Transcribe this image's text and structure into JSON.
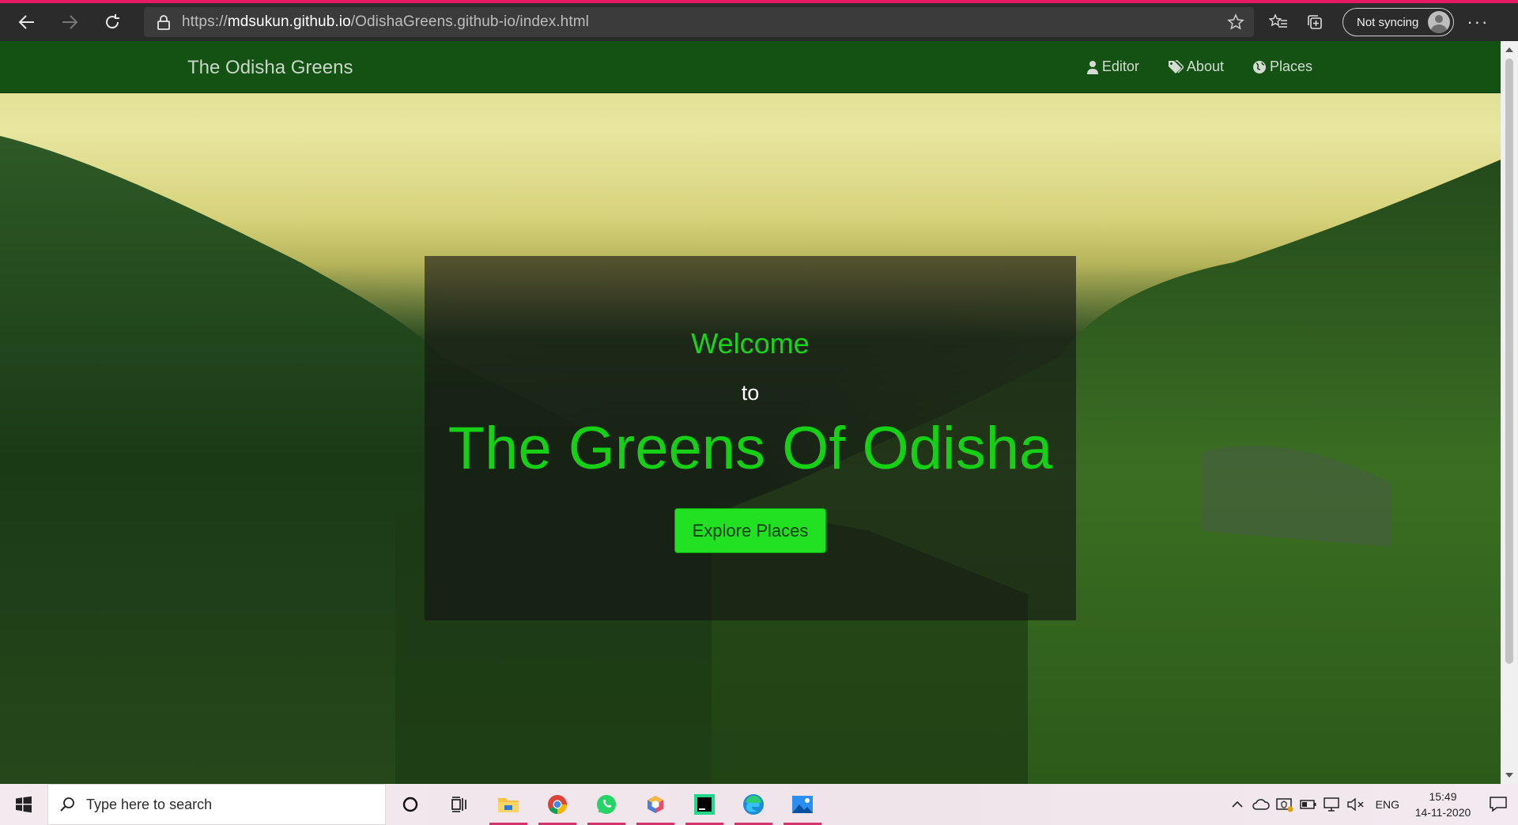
{
  "browser": {
    "url_scheme": "https://",
    "url_host": "mdsukun.github.io",
    "url_path": "/OdishaGreens.github-io/index.html",
    "sync_label": "Not syncing",
    "more_label": "···"
  },
  "site": {
    "brand": "The Odisha Greens",
    "menu": [
      {
        "label": "Editor",
        "icon": "user-icon"
      },
      {
        "label": "About",
        "icon": "tags-icon"
      },
      {
        "label": "Places",
        "icon": "globe-icon"
      }
    ]
  },
  "hero": {
    "welcome": "Welcome",
    "to": "to",
    "headline": "The Greens Of Odisha",
    "button": "Explore Places"
  },
  "taskbar": {
    "search_placeholder": "Type here to search",
    "language": "ENG",
    "time": "15:49",
    "date": "14-11-2020",
    "apps": [
      "cortana",
      "task-view",
      "file-explorer",
      "chrome",
      "whatsapp",
      "app-cube",
      "pycharm",
      "edge",
      "photos"
    ]
  },
  "colors": {
    "navbar": "#135212",
    "headline": "#16d016",
    "button": "#22e022",
    "taskbar_accent": "#d6336c"
  }
}
